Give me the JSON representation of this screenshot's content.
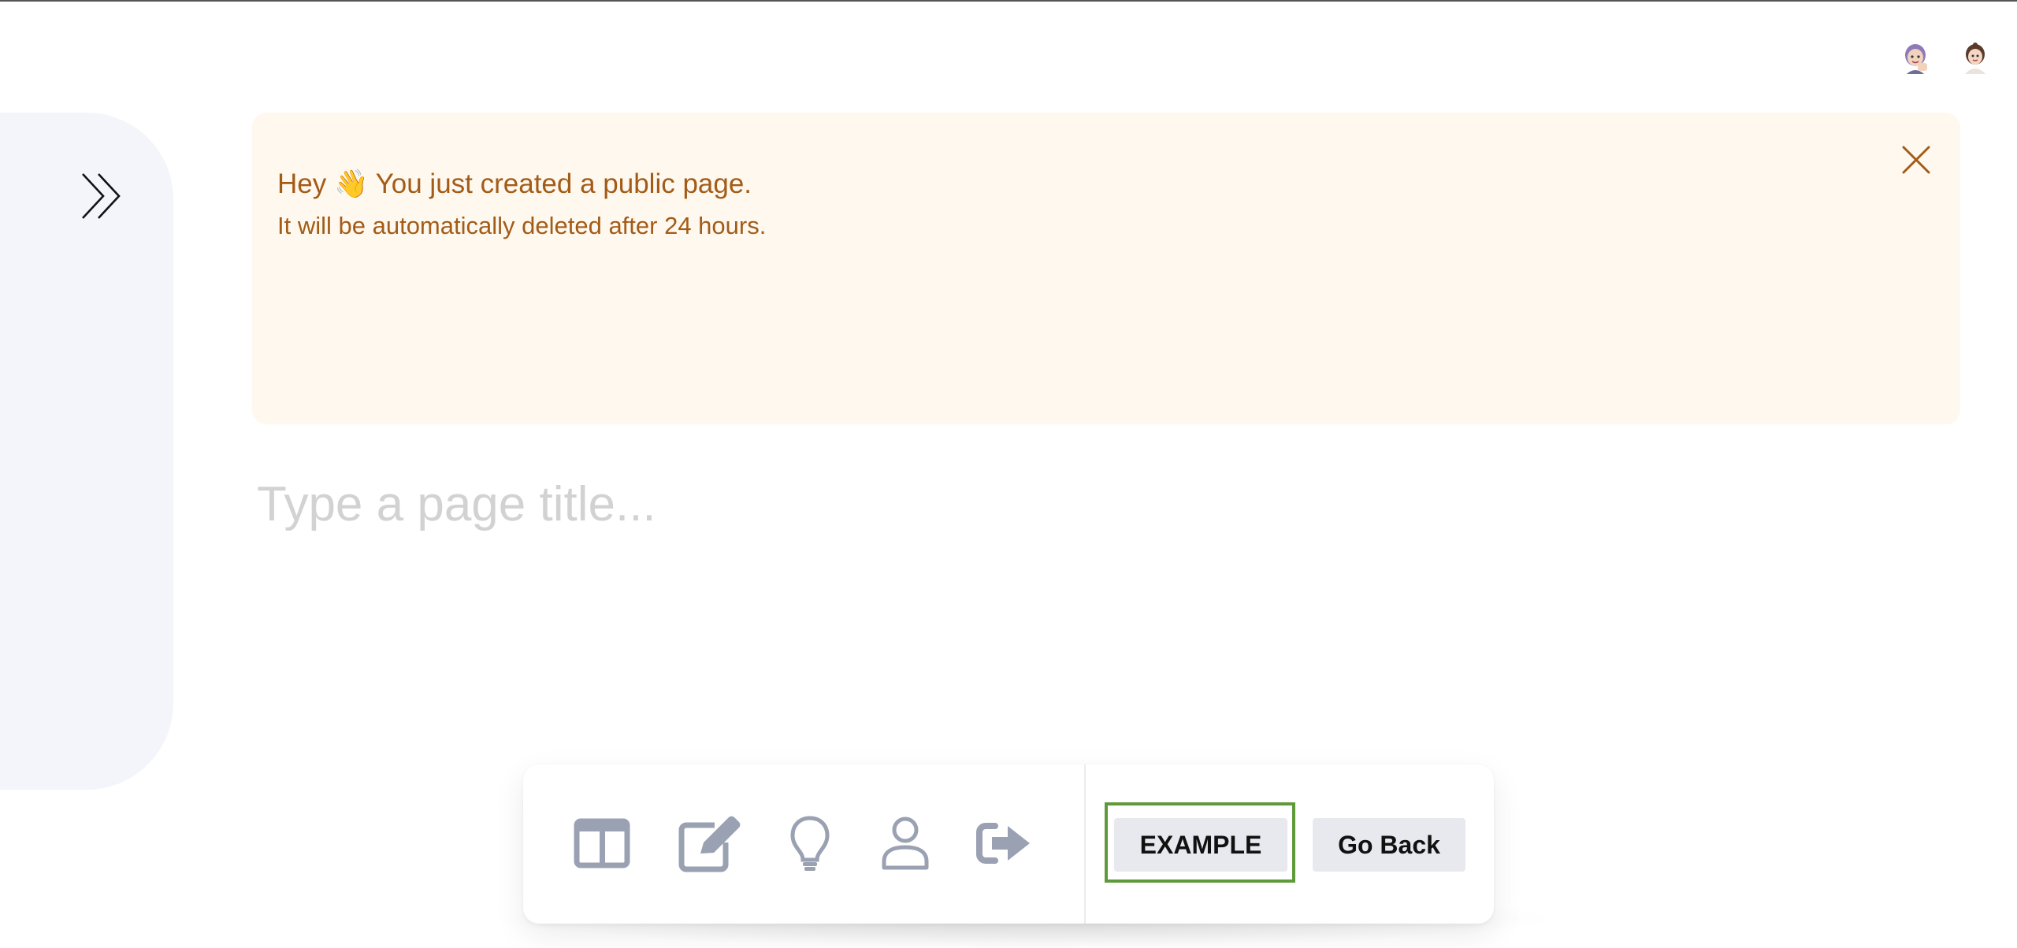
{
  "header": {
    "avatars": [
      {
        "name": "avatar-purple-hair"
      },
      {
        "name": "avatar-brown-hair"
      }
    ]
  },
  "sidebar": {
    "toggle_icon": "double-chevron-right-icon"
  },
  "banner": {
    "title": "Hey 👋 You just created a public page.",
    "body": "It will be automatically deleted after 24 hours.",
    "close_icon": "close-icon",
    "colors": {
      "background": "#fff8ef",
      "text": "#a25c18"
    }
  },
  "editor": {
    "title_placeholder": "Type a page title...",
    "title_value": ""
  },
  "toolbar": {
    "icons": [
      "layout-columns-icon",
      "edit-icon",
      "lightbulb-icon",
      "user-icon",
      "sign-out-icon"
    ],
    "example_label": "EXAMPLE",
    "go_back_label": "Go Back",
    "highlight_color": "#5e9a3a",
    "icon_color": "#9aa1b2"
  }
}
